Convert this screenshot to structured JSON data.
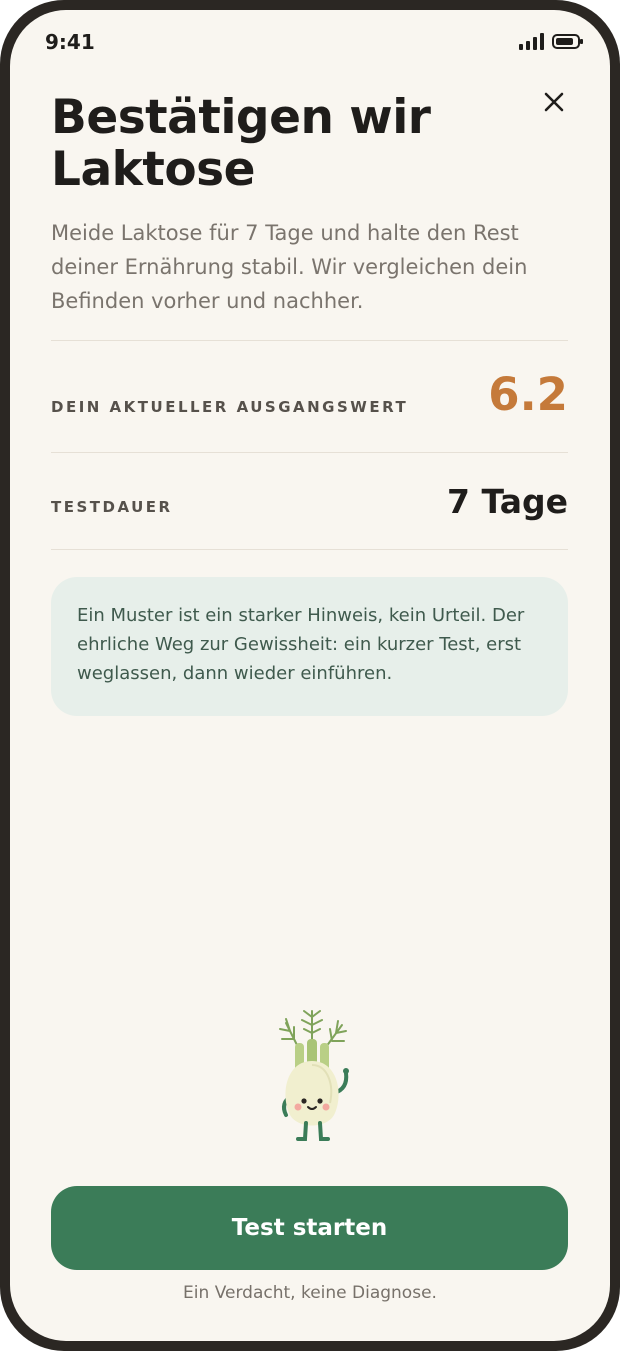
{
  "status_bar": {
    "time": "9:41",
    "signal_icon": "cellular-signal-icon",
    "battery_icon": "battery-icon"
  },
  "header": {
    "title": "Bestätigen wir Laktose",
    "close_icon": "close-icon"
  },
  "intro": "Meide Laktose für 7 Tage und halte den Rest deiner Ernährung stabil. Wir vergleichen dein Befinden vorher und nachher.",
  "baseline": {
    "label": "DEIN AKTUELLER AUSGANGSWERT",
    "value": "6.2"
  },
  "duration": {
    "label": "TESTDAUER",
    "value": "7 Tage"
  },
  "note": "Ein Muster ist ein starker Hinweis, kein Urteil. Der ehrliche Weg zur Gewissheit: ein kurzer Test, erst weglassen, dann wieder einführen.",
  "mascot": "fennel-mascot-illustration",
  "cta": {
    "label": "Test starten"
  },
  "disclaimer": "Ein Verdacht, keine Diagnose.",
  "colors": {
    "accent": "#c57a3a",
    "primary": "#3b7c58",
    "background": "#f9f6f0",
    "note_bg": "#e7efea"
  }
}
